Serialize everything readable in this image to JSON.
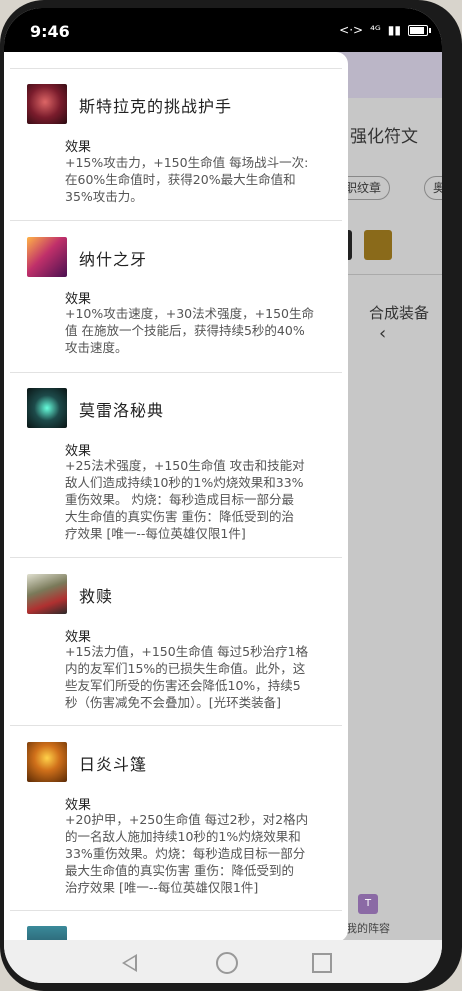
{
  "status_bar": {
    "time": "9:46",
    "signal_text": "⁴ᴳ"
  },
  "background_app": {
    "title": "强化符文",
    "chip_1": "转职纹章",
    "chip_2": "奥",
    "synth_label": "合成装备",
    "synth_chevron": "‹",
    "my_team": "我的阵容",
    "my_team_icon": "T"
  },
  "items": [
    {
      "name": "斯特拉克的挑战护手",
      "effect_label": "效果",
      "effect_lines": [
        "+15%攻击力，+150生命值 每场战斗一次:",
        "在60%生命值时，获得20%最大生命值和",
        "35%攻击力。"
      ],
      "icon_color": "#7a1c2c"
    },
    {
      "name": "纳什之牙",
      "effect_label": "效果",
      "effect_lines": [
        "+10%攻击速度，+30法术强度，+150生命",
        "值 在施放一个技能后，获得持续5秒的40%",
        "攻击速度。"
      ],
      "icon_color": "#8a2a6a"
    },
    {
      "name": "莫雷洛秘典",
      "effect_label": "效果",
      "effect_lines": [
        "+25法术强度，+150生命值 攻击和技能对",
        "敌人们造成持续10秒的1%灼烧效果和33%",
        "重伤效果。 灼烧：每秒造成目标一部分最",
        "大生命值的真实伤害 重伤：降低受到的治",
        "疗效果 [唯一--每位英雄仅限1件]"
      ],
      "icon_color": "#1d4a4a"
    },
    {
      "name": "救赎",
      "effect_label": "效果",
      "effect_lines": [
        "+15法力值，+150生命值 每过5秒治疗1格",
        "内的友军们15%的已损失生命值。此外，这",
        "些友军们所受的伤害还会降低10%，持续5",
        "秒（伤害减免不会叠加）。[光环类装备]"
      ],
      "icon_color": "#5a5a3a"
    },
    {
      "name": "日炎斗篷",
      "effect_label": "效果",
      "effect_lines": [
        "+20护甲，+250生命值 每过2秒，对2格内",
        "的一名敌人施加持续10秒的1%灼烧效果和",
        "33%重伤效果。灼烧：每秒造成目标一部分",
        "最大生命值的真实伤害 重伤：降低受到的",
        "治疗效果 [唯一--每位英雄仅限1件]"
      ],
      "icon_color": "#a0520e"
    }
  ]
}
